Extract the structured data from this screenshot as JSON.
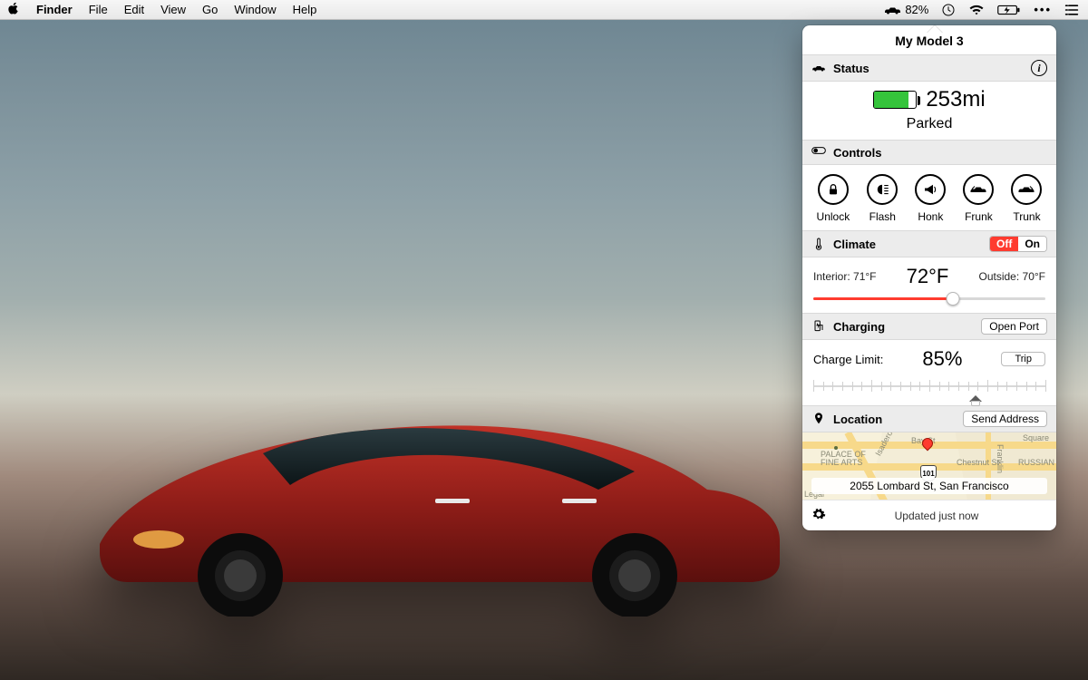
{
  "menubar": {
    "app": "Finder",
    "items": [
      "File",
      "Edit",
      "View",
      "Go",
      "Window",
      "Help"
    ],
    "battery_pct": "82%"
  },
  "popover": {
    "title": "My Model 3",
    "status": {
      "heading": "Status",
      "range": "253mi",
      "battery_fill_pct": 82,
      "state": "Parked"
    },
    "controls": {
      "heading": "Controls",
      "items": [
        {
          "label": "Unlock",
          "name": "unlock"
        },
        {
          "label": "Flash",
          "name": "flash"
        },
        {
          "label": "Honk",
          "name": "honk"
        },
        {
          "label": "Frunk",
          "name": "frunk"
        },
        {
          "label": "Trunk",
          "name": "trunk"
        }
      ]
    },
    "climate": {
      "heading": "Climate",
      "toggle": {
        "off": "Off",
        "on": "On",
        "active": "off"
      },
      "interior_label": "Interior: 71°F",
      "target": "72°F",
      "outside_label": "Outside: 70°F",
      "slider_pos_pct": 60
    },
    "charging": {
      "heading": "Charging",
      "open_port": "Open Port",
      "limit_label": "Charge Limit:",
      "limit_value": "85%",
      "trip_label": "Trip",
      "marker_pct": 70
    },
    "location": {
      "heading": "Location",
      "send": "Send Address",
      "address": "2055 Lombard St, San Francisco",
      "map_labels": {
        "bay": "Bay St",
        "chestnut": "Chestnut St",
        "palace": "PALACE OF\nFINE ARTS",
        "russian": "RUSSIAN",
        "isadero": "Isadero St",
        "franklin": "Franklin",
        "square": "Square",
        "legal": "Legal",
        "route": "101"
      }
    },
    "footer": {
      "updated": "Updated just now"
    }
  }
}
